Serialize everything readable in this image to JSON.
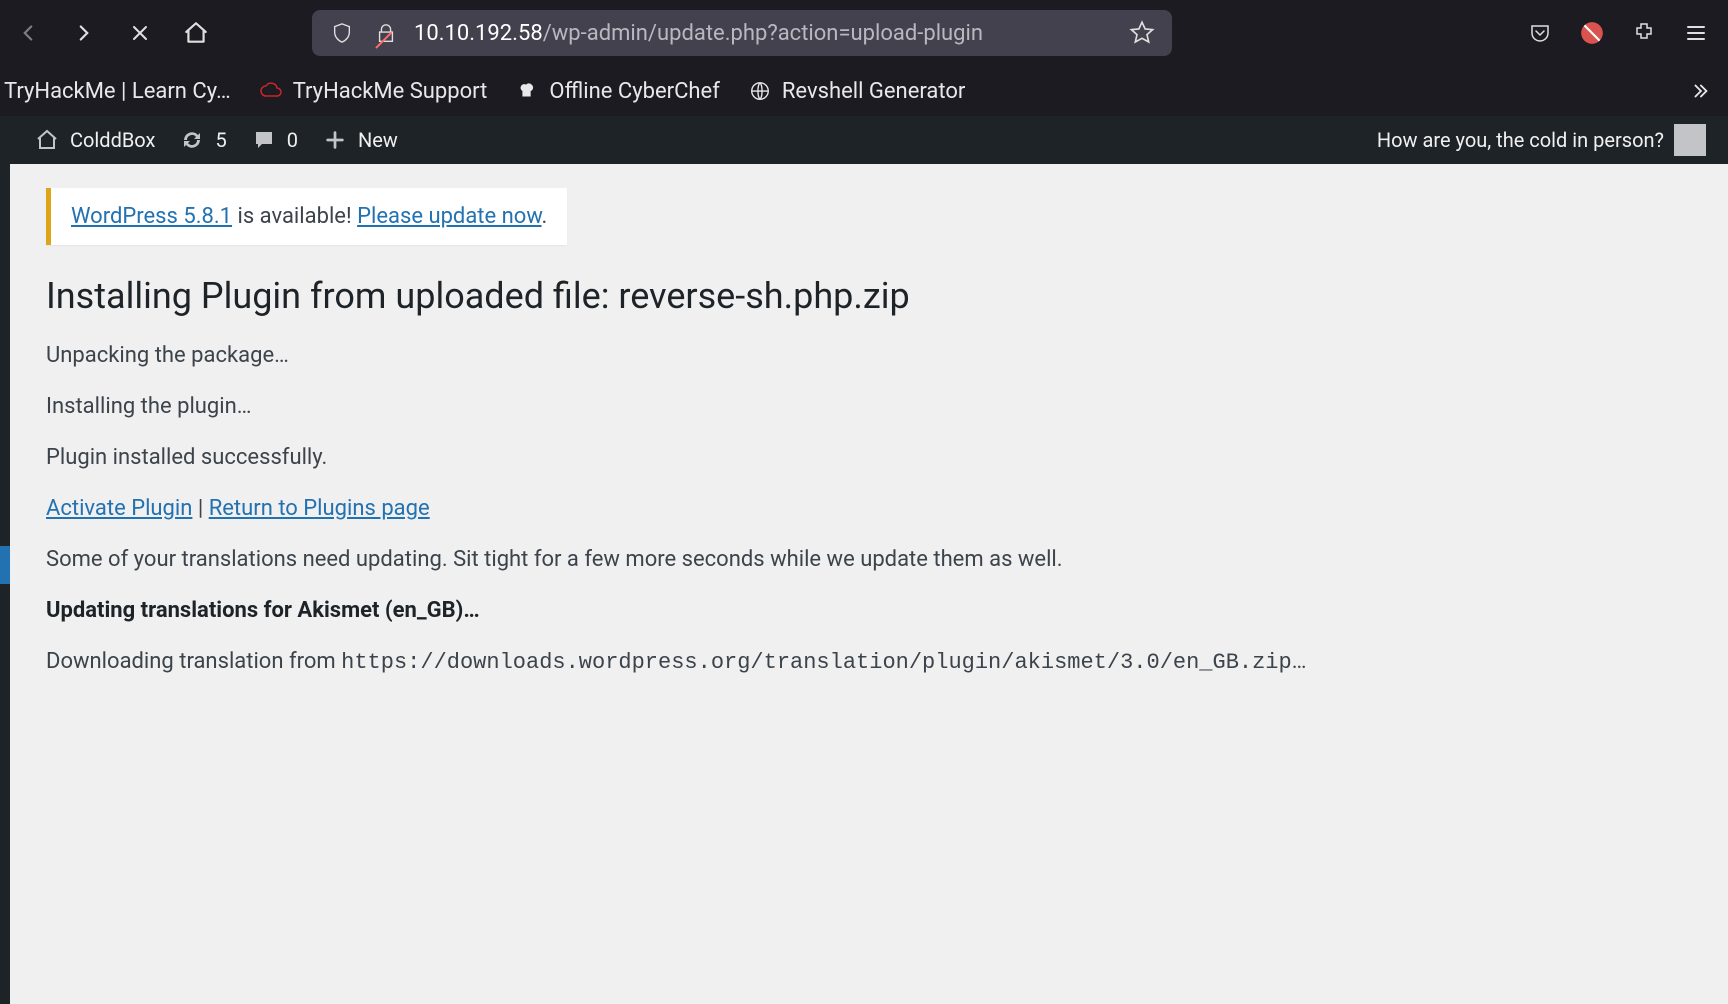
{
  "browser": {
    "url_host": "10.10.192.58",
    "url_path": "/wp-admin/update.php?action=upload-plugin"
  },
  "bookmarks": [
    {
      "label": "TryHackMe | Learn Cy…"
    },
    {
      "label": "TryHackMe Support"
    },
    {
      "label": "Offline CyberChef"
    },
    {
      "label": "Revshell Generator"
    }
  ],
  "wp_adminbar": {
    "site_name": "ColddBox",
    "updates_count": "5",
    "comments_count": "0",
    "new_label": "New",
    "greeting": "How are you, the cold in person?"
  },
  "update_nag": {
    "version_link": "WordPress 5.8.1",
    "middle_text": " is available! ",
    "action_link": "Please update now",
    "trailing": "."
  },
  "page_title": "Installing Plugin from uploaded file: reverse-sh.php.zip",
  "status": {
    "unpacking": "Unpacking the package…",
    "installing": "Installing the plugin…",
    "success": "Plugin installed successfully.",
    "activate_link": "Activate Plugin",
    "separator": " | ",
    "return_link": "Return to Plugins page",
    "translations_note": "Some of your translations need updating. Sit tight for a few more seconds while we update them as well.",
    "updating_translations": "Updating translations for Akismet (en_GB)…",
    "downloading_prefix": "Downloading translation from ",
    "downloading_url": "https://downloads.wordpress.org/translation/plugin/akismet/3.0/en_GB.zip",
    "downloading_suffix": "…"
  }
}
